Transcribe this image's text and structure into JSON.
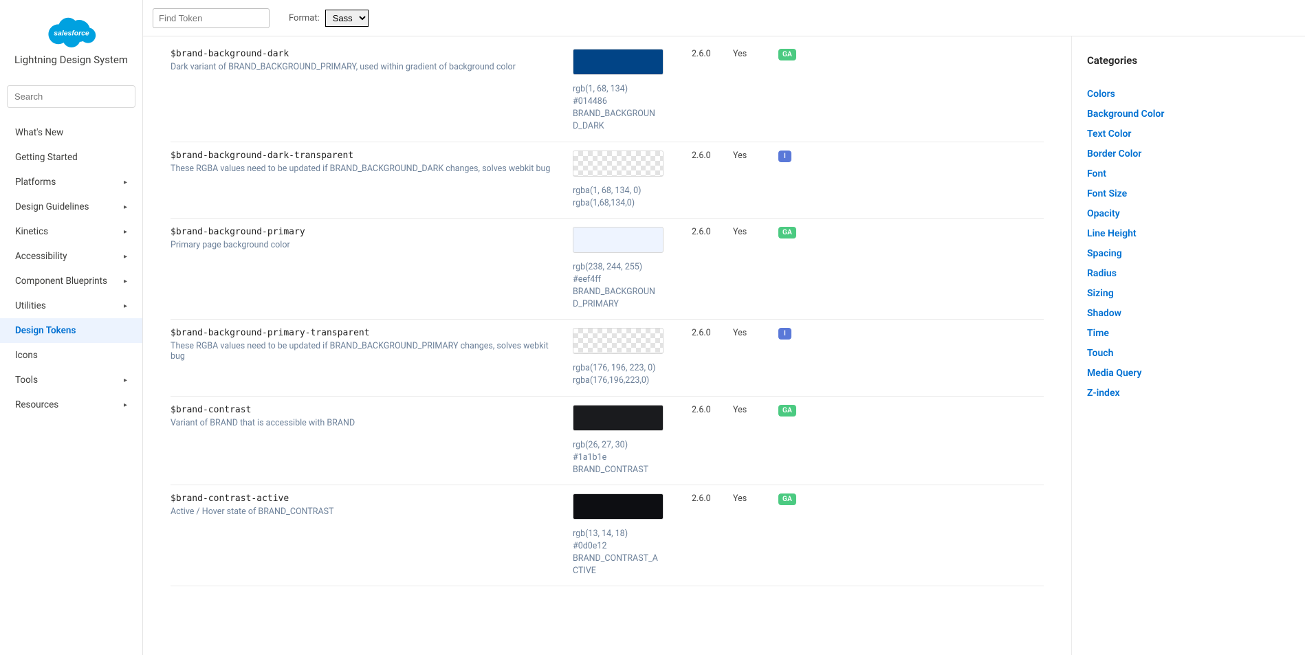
{
  "brand": {
    "title": "Lightning Design System",
    "logo_text": "salesforce"
  },
  "sidebar": {
    "search_placeholder": "Search",
    "items": [
      {
        "label": "What's New",
        "expandable": false
      },
      {
        "label": "Getting Started",
        "expandable": false
      },
      {
        "label": "Platforms",
        "expandable": true
      },
      {
        "label": "Design Guidelines",
        "expandable": true
      },
      {
        "label": "Kinetics",
        "expandable": true
      },
      {
        "label": "Accessibility",
        "expandable": true
      },
      {
        "label": "Component Blueprints",
        "expandable": true
      },
      {
        "label": "Utilities",
        "expandable": true
      },
      {
        "label": "Design Tokens",
        "expandable": false,
        "active": true
      },
      {
        "label": "Icons",
        "expandable": false
      },
      {
        "label": "Tools",
        "expandable": true
      },
      {
        "label": "Resources",
        "expandable": true
      }
    ]
  },
  "topbar": {
    "find_placeholder": "Find Token",
    "format_label": "Format:",
    "format_options": [
      "Sass"
    ],
    "format_selected": "Sass"
  },
  "tokens": [
    {
      "name": "$brand-background-dark",
      "desc": "Dark variant of BRAND_BACKGROUND_PRIMARY, used within gradient of background color",
      "swatch_color": "#014486",
      "transparent": false,
      "values": [
        "rgb(1, 68, 134)",
        "#014486",
        "BRAND_BACKGROUND_DARK"
      ],
      "release": "2.6.0",
      "themeable": "Yes",
      "badge": "GA"
    },
    {
      "name": "$brand-background-dark-transparent",
      "desc": "These RGBA values need to be updated if BRAND_BACKGROUND_DARK changes, solves webkit bug",
      "swatch_color": null,
      "transparent": true,
      "values": [
        "rgba(1, 68, 134, 0)",
        "rgba(1,68,134,0)"
      ],
      "release": "2.6.0",
      "themeable": "Yes",
      "badge": "I"
    },
    {
      "name": "$brand-background-primary",
      "desc": "Primary page background color",
      "swatch_color": "#eef4ff",
      "transparent": false,
      "values": [
        "rgb(238, 244, 255)",
        "#eef4ff",
        "BRAND_BACKGROUND_PRIMARY"
      ],
      "release": "2.6.0",
      "themeable": "Yes",
      "badge": "GA"
    },
    {
      "name": "$brand-background-primary-transparent",
      "desc": "These RGBA values need to be updated if BRAND_BACKGROUND_PRIMARY changes, solves webkit bug",
      "swatch_color": null,
      "transparent": true,
      "values": [
        "rgba(176, 196, 223, 0)",
        "rgba(176,196,223,0)"
      ],
      "release": "2.6.0",
      "themeable": "Yes",
      "badge": "I"
    },
    {
      "name": "$brand-contrast",
      "desc": "Variant of BRAND that is accessible with BRAND",
      "swatch_color": "#1a1b1e",
      "transparent": false,
      "values": [
        "rgb(26, 27, 30)",
        "#1a1b1e",
        "BRAND_CONTRAST"
      ],
      "release": "2.6.0",
      "themeable": "Yes",
      "badge": "GA"
    },
    {
      "name": "$brand-contrast-active",
      "desc": "Active / Hover state of BRAND_CONTRAST",
      "swatch_color": "#0d0e12",
      "transparent": false,
      "values": [
        "rgb(13, 14, 18)",
        "#0d0e12",
        "BRAND_CONTRAST_ACTIVE"
      ],
      "release": "2.6.0",
      "themeable": "Yes",
      "badge": "GA"
    }
  ],
  "right": {
    "heading": "Categories",
    "items": [
      "Colors",
      "Background Color",
      "Text Color",
      "Border Color",
      "Font",
      "Font Size",
      "Opacity",
      "Line Height",
      "Spacing",
      "Radius",
      "Sizing",
      "Shadow",
      "Time",
      "Touch",
      "Media Query",
      "Z-index"
    ]
  }
}
